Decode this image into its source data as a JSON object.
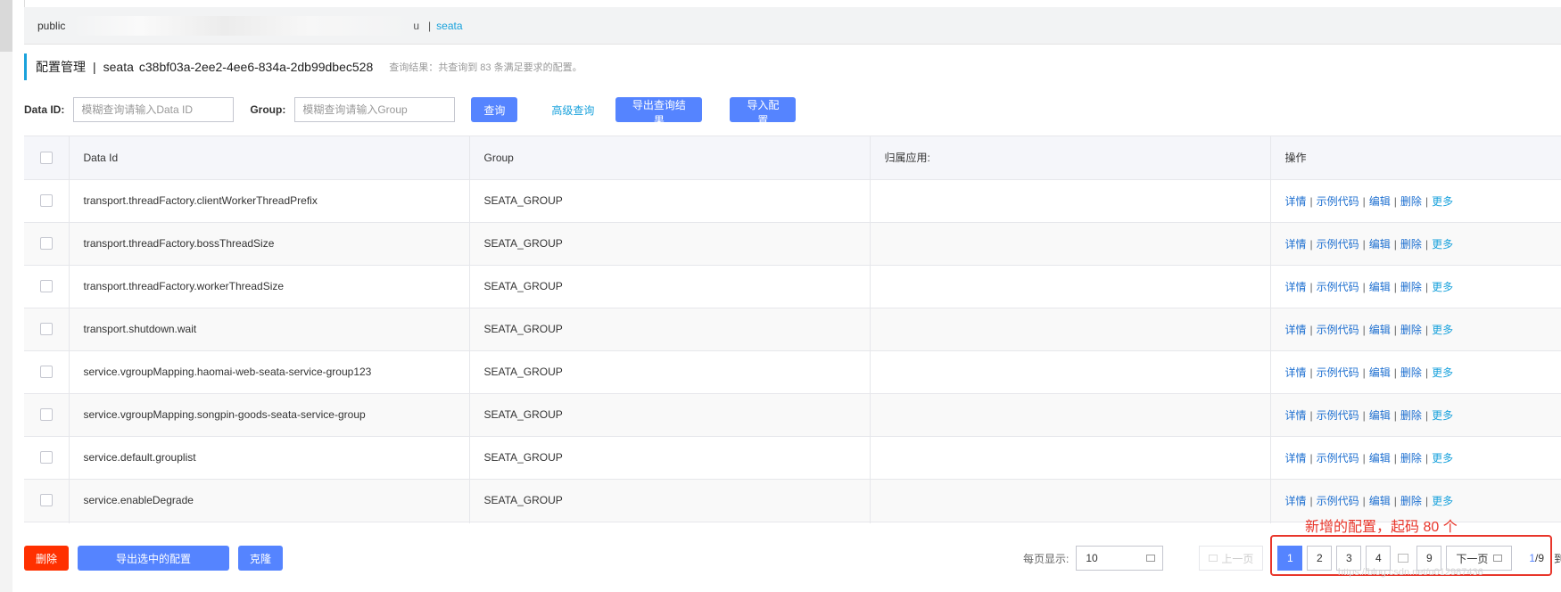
{
  "namespace_bar": {
    "public_label": "public",
    "obscured_suffix": "u",
    "active_namespace": "seata"
  },
  "header": {
    "title": "配置管理",
    "separator": "|",
    "namespace": "seata",
    "namespace_id": "c38bf03a-2ee2-4ee6-834a-2db99dbec528",
    "query_result": "查询结果：共查询到 83 条满足要求的配置。"
  },
  "search": {
    "data_id_label": "Data ID:",
    "data_id_placeholder": "模糊查询请输入Data ID",
    "group_label": "Group:",
    "group_placeholder": "模糊查询请输入Group",
    "query_button": "查询",
    "advanced_query": "高级查询",
    "export_query_button": "导出查询结果",
    "import_button": "导入配置"
  },
  "table": {
    "columns": [
      "Data Id",
      "Group",
      "归属应用:",
      "操作"
    ],
    "ops": {
      "detail": "详情",
      "sample": "示例代码",
      "edit": "编辑",
      "delete": "删除",
      "more": "更多",
      "sep": "|"
    },
    "rows": [
      {
        "data_id": "transport.threadFactory.clientWorkerThreadPrefix",
        "group": "SEATA_GROUP",
        "app": ""
      },
      {
        "data_id": "transport.threadFactory.bossThreadSize",
        "group": "SEATA_GROUP",
        "app": ""
      },
      {
        "data_id": "transport.threadFactory.workerThreadSize",
        "group": "SEATA_GROUP",
        "app": ""
      },
      {
        "data_id": "transport.shutdown.wait",
        "group": "SEATA_GROUP",
        "app": ""
      },
      {
        "data_id": "service.vgroupMapping.haomai-web-seata-service-group123",
        "group": "SEATA_GROUP",
        "app": ""
      },
      {
        "data_id": "service.vgroupMapping.songpin-goods-seata-service-group",
        "group": "SEATA_GROUP",
        "app": ""
      },
      {
        "data_id": "service.default.grouplist",
        "group": "SEATA_GROUP",
        "app": ""
      },
      {
        "data_id": "service.enableDegrade",
        "group": "SEATA_GROUP",
        "app": ""
      }
    ]
  },
  "bottom": {
    "delete_button": "删除",
    "export_selected_button": "导出选中的配置",
    "clone_button": "克隆"
  },
  "pager": {
    "page_size_label": "每页显示:",
    "page_size": "10",
    "prev": "上一页",
    "pages": [
      "1",
      "2",
      "3",
      "4"
    ],
    "last_page": "9",
    "next": "下一页",
    "current": "1",
    "total": "/9"
  },
  "annotation": {
    "text": "新增的配置，起码 80 个",
    "watermark": "https://blog.csdn.net/u012987436"
  }
}
